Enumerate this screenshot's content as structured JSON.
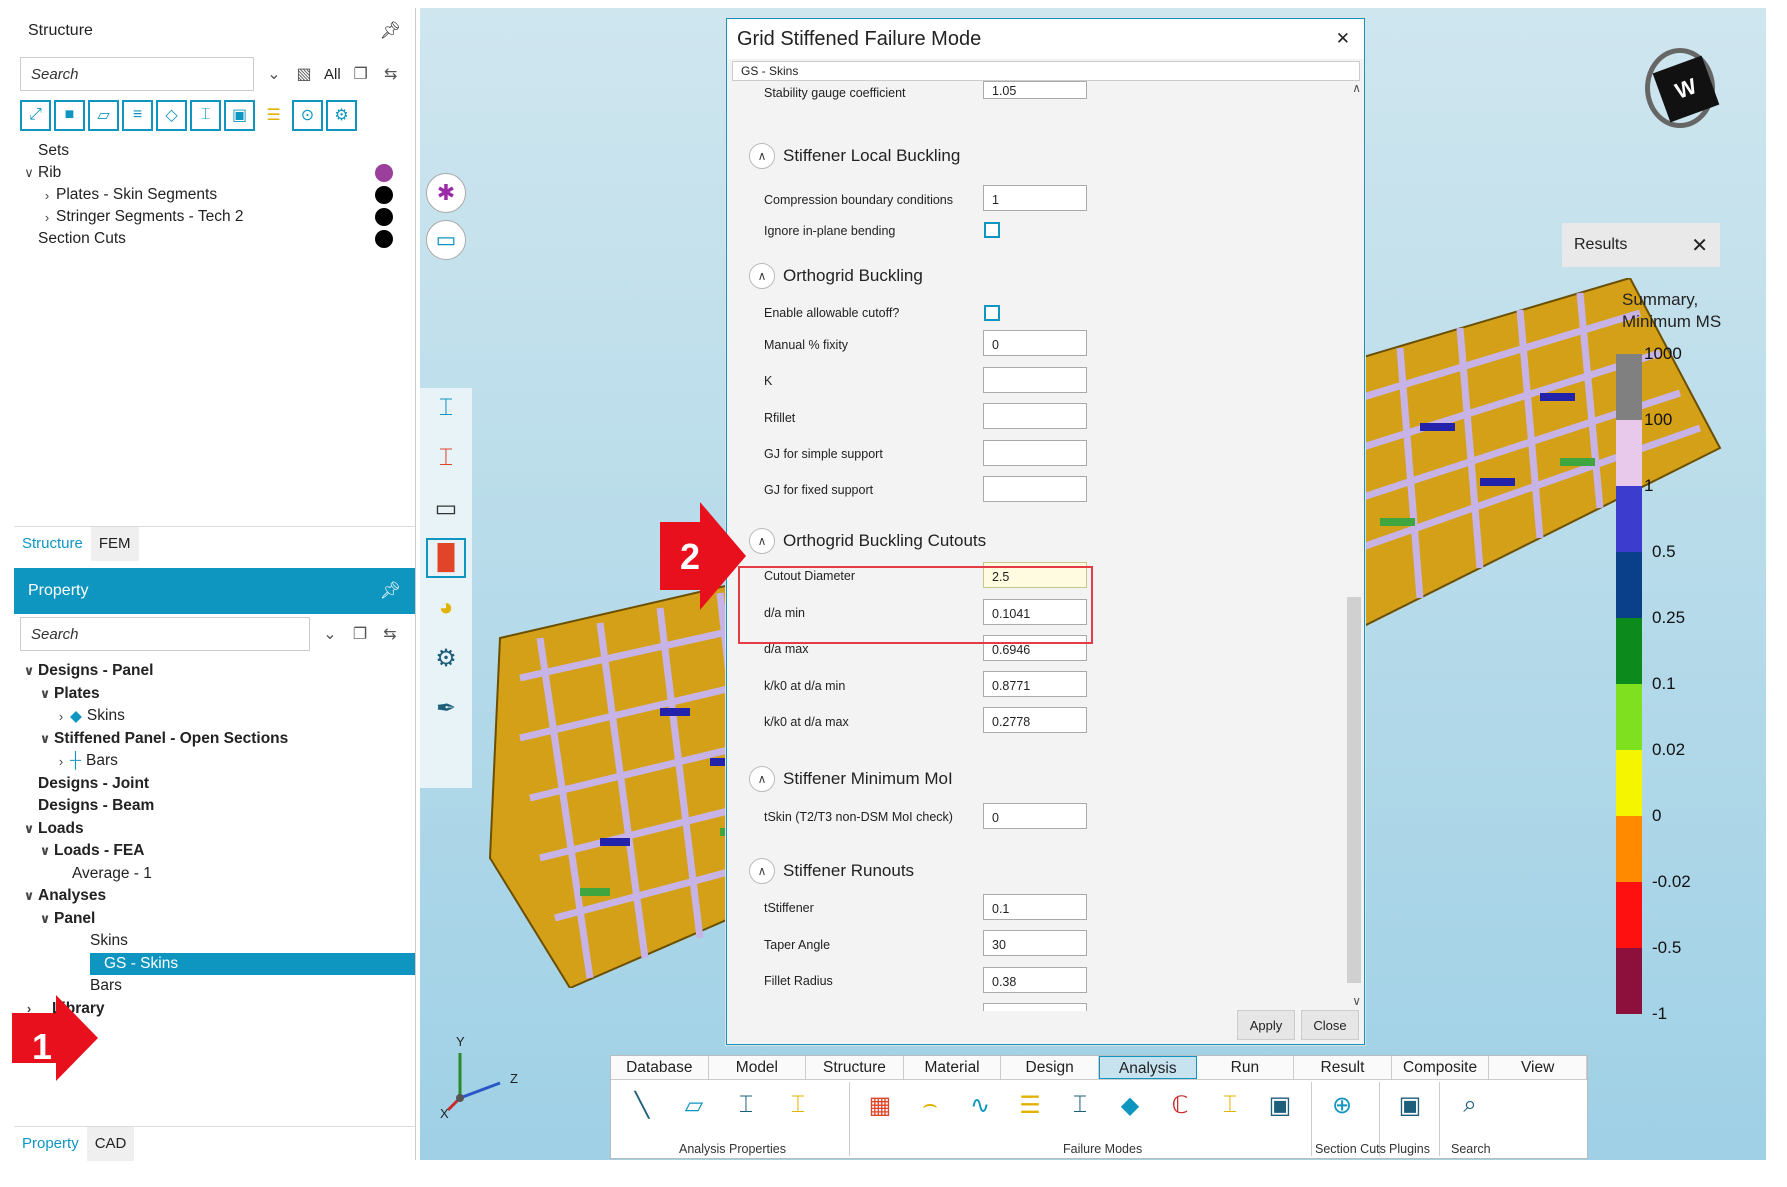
{
  "structure_panel": {
    "title": "Structure",
    "search_placeholder": "Search",
    "filter_all": "All",
    "tree": {
      "sets": "Sets",
      "rib": "Rib",
      "plates": "Plates - Skin Segments",
      "stringers": "Stringer Segments - Tech 2",
      "section_cuts": "Section Cuts"
    },
    "tabs": [
      "Structure",
      "FEM"
    ]
  },
  "property_panel": {
    "title": "Property",
    "search_placeholder": "Search",
    "tree": {
      "designs_panel": "Designs - Panel",
      "plates": "Plates",
      "skins": "Skins",
      "stiffened_panel": "Stiffened Panel - Open Sections",
      "bars": "Bars",
      "designs_joint": "Designs - Joint",
      "designs_beam": "Designs - Beam",
      "loads": "Loads",
      "loads_fea": "Loads - FEA",
      "average": "Average - 1",
      "analyses": "Analyses",
      "panel": "Panel",
      "analyses_skins": "Skins",
      "gs_skins": "GS - Skins",
      "analyses_bars": "Bars",
      "library": "Library"
    },
    "tabs": [
      "Property",
      "CAD"
    ]
  },
  "dialog": {
    "title": "Grid Stiffened Failure Mode",
    "tab": "GS - Skins",
    "top_field": {
      "label": "Stability gauge coefficient",
      "value": "1.05"
    },
    "sections": {
      "stiffener_local": "Stiffener Local Buckling",
      "orthogrid": "Orthogrid Buckling",
      "cutouts": "Orthogrid Buckling Cutouts",
      "min_moi": "Stiffener Minimum MoI",
      "runouts": "Stiffener Runouts"
    },
    "fields": {
      "compression_bc": {
        "label": "Compression boundary conditions",
        "value": "1"
      },
      "ignore_inplane": {
        "label": "Ignore in-plane bending"
      },
      "enable_cutoff": {
        "label": "Enable allowable cutoff?"
      },
      "manual_fixity": {
        "label": "Manual % fixity",
        "value": "0"
      },
      "k": {
        "label": "K",
        "value": ""
      },
      "rfillet": {
        "label": "Rfillet",
        "value": ""
      },
      "gj_simple": {
        "label": "GJ for simple support",
        "value": ""
      },
      "gj_fixed": {
        "label": "GJ for fixed support",
        "value": ""
      },
      "cutout_diameter": {
        "label": "Cutout Diameter",
        "value": "2.5"
      },
      "da_min": {
        "label": "d/a min",
        "value": "0.1041"
      },
      "da_max": {
        "label": "d/a max",
        "value": "0.6946"
      },
      "k0_min": {
        "label": "k/k0 at d/a min",
        "value": "0.8771"
      },
      "k0_max": {
        "label": "k/k0 at d/a max",
        "value": "0.2778"
      },
      "tskin": {
        "label": "tSkin (T2/T3 non-DSM MoI check)",
        "value": "0"
      },
      "tstiffener": {
        "label": "tStiffener",
        "value": "0.1"
      },
      "taper": {
        "label": "Taper Angle",
        "value": "30"
      },
      "fillet_radius": {
        "label": "Fillet Radius",
        "value": "0.38"
      }
    },
    "apply": "Apply",
    "close": "Close"
  },
  "results": {
    "title": "Results",
    "legend_title_line1": "Summary,",
    "legend_title_line2": "Minimum MS",
    "labels": [
      "1000",
      "100",
      "1",
      "0.5",
      "0.25",
      "0.1",
      "0.02",
      "0",
      "-0.02",
      "-0.5",
      "-1"
    ],
    "colors": [
      "#808080",
      "#e8c9ec",
      "#3c3ccf",
      "#0a3f8a",
      "#0c8a1c",
      "#7fe01f",
      "#f5f500",
      "#ff8a00",
      "#ff1010",
      "#8c0f3c"
    ]
  },
  "axes": {
    "y": "Y",
    "z": "Z",
    "x": "X"
  },
  "ribbon": {
    "tabs": [
      "Database",
      "Model",
      "Structure",
      "Material",
      "Design",
      "Analysis",
      "Run",
      "Result",
      "Composite",
      "View"
    ],
    "active_tab": "Analysis",
    "groups": {
      "analysis_properties": "Analysis Properties",
      "failure_modes": "Failure Modes",
      "section_cuts": "Section Cuts",
      "plugins": "Plugins",
      "search": "Search"
    }
  },
  "callouts": [
    "1",
    "2"
  ],
  "colors": {
    "accent": "#0e96c1",
    "highlight_box": "#e53c43",
    "callout_red": "#e8101c"
  }
}
